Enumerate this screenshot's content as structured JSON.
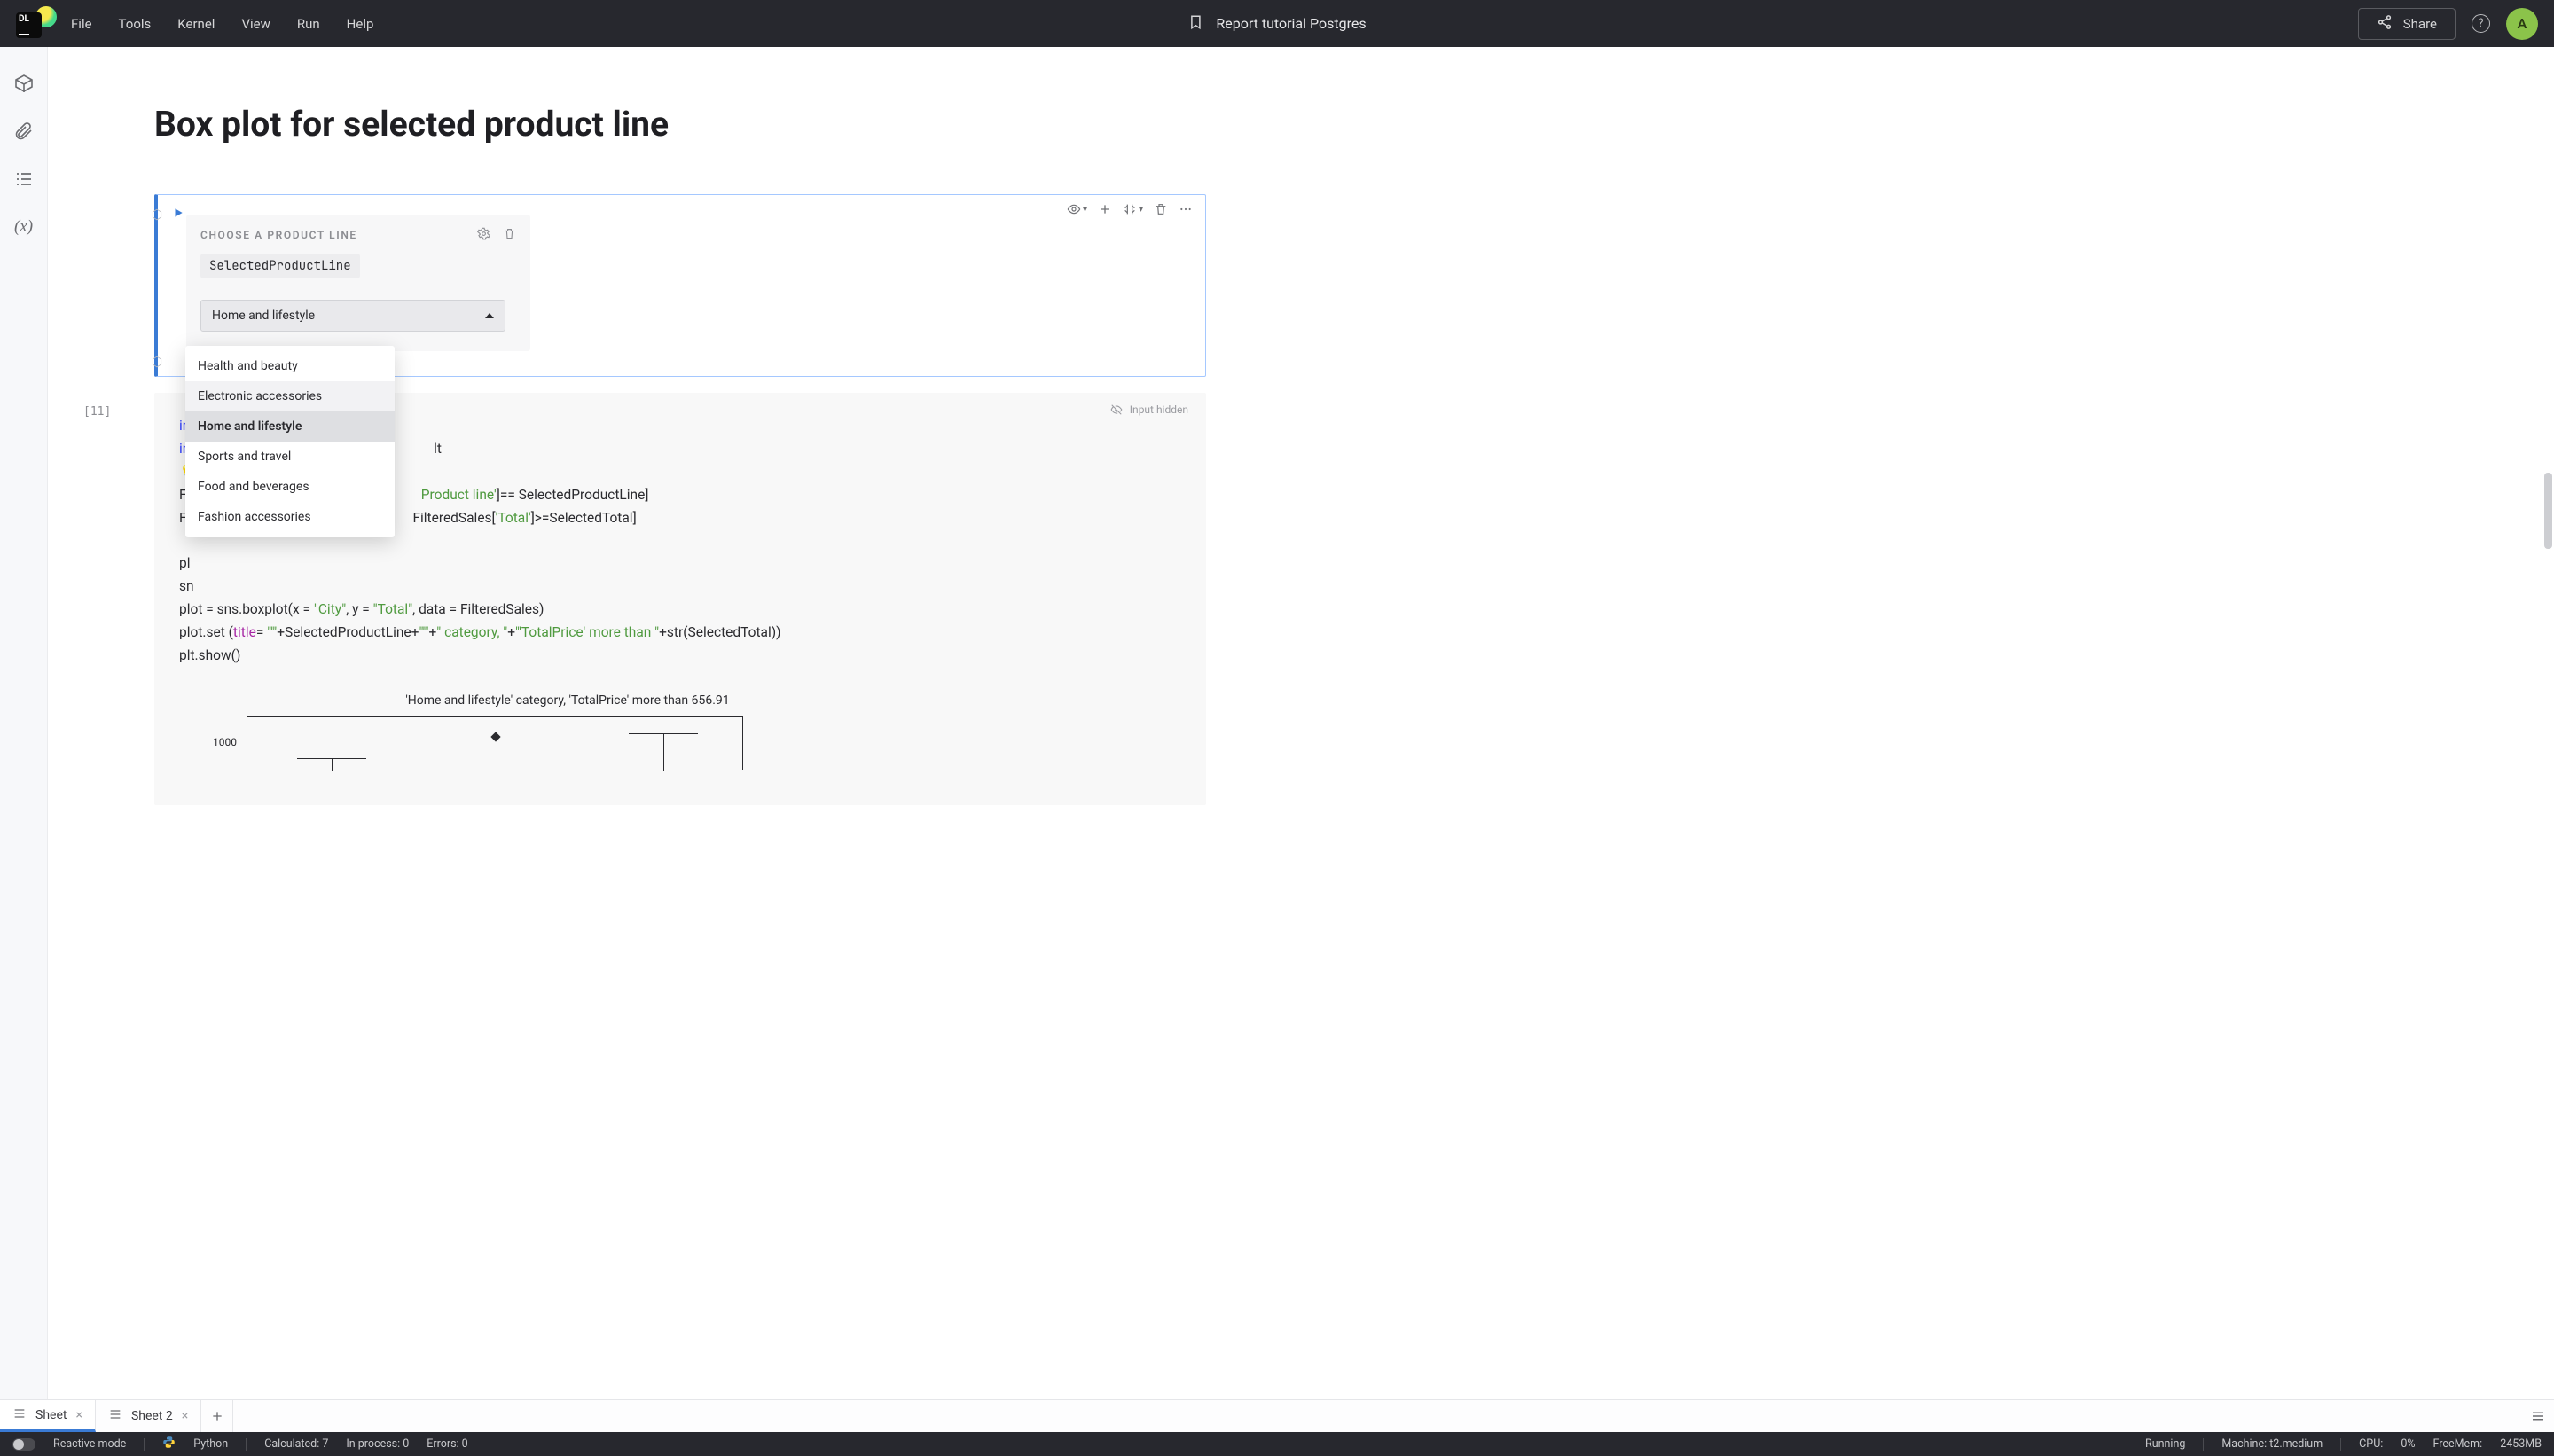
{
  "menu": {
    "file": "File",
    "tools": "Tools",
    "kernel": "Kernel",
    "view": "View",
    "run": "Run",
    "help": "Help"
  },
  "doc": {
    "title": "Report tutorial Postgres"
  },
  "share": {
    "label": "Share"
  },
  "avatar": {
    "initial": "A"
  },
  "page": {
    "heading": "Box plot for selected product line"
  },
  "widget": {
    "caption": "CHOOSE A PRODUCT LINE",
    "variable": "SelectedProductLine",
    "selected": "Home and lifestyle",
    "options": [
      {
        "label": "Health and beauty",
        "state": ""
      },
      {
        "label": "Electronic accessories",
        "state": "hover"
      },
      {
        "label": "Home and lifestyle",
        "state": "sel"
      },
      {
        "label": "Sports and travel",
        "state": ""
      },
      {
        "label": "Food and beverages",
        "state": ""
      },
      {
        "label": "Fashion accessories",
        "state": ""
      }
    ]
  },
  "cell2": {
    "exec_label": "[11]",
    "hidden_label": "Input hidden",
    "code_visible": {
      "l1_a": "im",
      "l2_a": "im",
      "l2_b": "lt",
      "l4_a": "Fi",
      "l4_b": "Product line'",
      "l4_c": "]== SelectedProductLine]",
      "l5_a": "Fi",
      "l5_b": "FilteredSales[",
      "l5_c": "'Total'",
      "l5_d": "]>=SelectedTotal]",
      "l7": "pl",
      "l8": "sn",
      "l9_a": "plot = sns.boxplot(x = ",
      "l9_b": "\"City\"",
      "l9_c": ", y = ",
      "l9_d": "\"Total\"",
      "l9_e": ", data = FilteredSales)",
      "l10_a": "plot.set (",
      "l10_b": "title",
      "l10_c": "= ",
      "l10_d": "\"'\"",
      "l10_e": "+SelectedProductLine+",
      "l10_f": "\"'\"",
      "l10_g": "+",
      "l10_h": "\" category, \"",
      "l10_i": "+",
      "l10_j": "\"'TotalPrice' more than \"",
      "l10_k": "+str(SelectedTotal))",
      "l11": "plt.show()"
    }
  },
  "chart_data": {
    "type": "box",
    "title": "'Home and lifestyle' category, 'TotalPrice' more than 656.91",
    "y_tick": "1000"
  },
  "sheets": {
    "active": "Sheet",
    "other": "Sheet 2"
  },
  "status": {
    "reactive": "Reactive mode",
    "python": "Python",
    "calc": "Calculated: 7",
    "inproc": "In process: 0",
    "errors": "Errors: 0",
    "running": "Running",
    "machine": "Machine: t2.medium",
    "cpu_lbl": "CPU:",
    "cpu_val": "0%",
    "mem_lbl": "FreeMem:",
    "mem_val": "2453MB"
  }
}
